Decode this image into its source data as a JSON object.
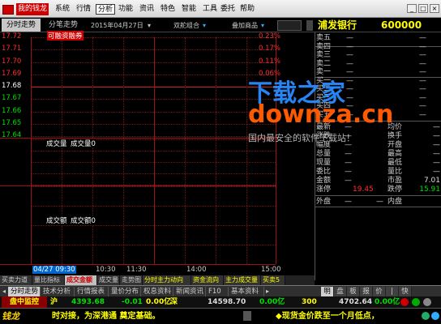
{
  "title_bar": {
    "app_button": "我的钱龙",
    "menu": [
      "系统",
      "行情",
      "分析",
      "功能",
      "资讯",
      "特色",
      "智能",
      "工具",
      "委托",
      "帮助"
    ],
    "selected_menu": "分析"
  },
  "tabs": {
    "tab1": "分时走势",
    "tab2": "分笔走势",
    "date": "2015年04月27日",
    "combo": "双舵组合",
    "overlay": "叠加商品"
  },
  "stock": {
    "name": "浦发银行",
    "code": "600000"
  },
  "chart": {
    "price_labels": [
      "17.72",
      "17.71",
      "17.70",
      "17.69",
      "17.68",
      "17.67",
      "17.66",
      "17.65",
      "17.64"
    ],
    "pct_labels": [
      "0.23%",
      "0.17%",
      "0.11%",
      "0.06%"
    ],
    "ref_price": "17.68",
    "panel_label_margin": "可融资融券",
    "vol_panel_title": "成交量",
    "vol_panel_value": "成交量0",
    "amt_panel_title": "成交额",
    "amt_panel_value": "成交额0",
    "x_labels": [
      "04/27 09:30",
      "10:30",
      "11:30",
      "14:00",
      "15:00"
    ]
  },
  "orderbook": {
    "asks": [
      {
        "label": "卖五",
        "price": "—",
        "vol": "—"
      },
      {
        "label": "卖四",
        "price": "—",
        "vol": "—"
      },
      {
        "label": "卖三",
        "price": "—",
        "vol": "—"
      },
      {
        "label": "卖二",
        "price": "—",
        "vol": "—"
      },
      {
        "label": "卖一",
        "price": "—",
        "vol": "—"
      }
    ],
    "bids": [
      {
        "label": "买一",
        "price": "—",
        "vol": "—"
      },
      {
        "label": "买二",
        "price": "—",
        "vol": "—"
      },
      {
        "label": "买三",
        "price": "—",
        "vol": "—"
      },
      {
        "label": "买四",
        "price": "—",
        "vol": "—"
      },
      {
        "label": "买五",
        "price": "—",
        "vol": "—"
      }
    ]
  },
  "stats": [
    {
      "l1": "最新",
      "v1": "—",
      "l2": "均价",
      "v2": "—"
    },
    {
      "l1": "涨跌",
      "v1": "—",
      "l2": "换手",
      "v2": "—"
    },
    {
      "l1": "幅度",
      "v1": "—",
      "l2": "开盘",
      "v2": "—"
    },
    {
      "l1": "总量",
      "v1": "—",
      "l2": "最高",
      "v2": "—"
    },
    {
      "l1": "现量",
      "v1": "—",
      "l2": "最低",
      "v2": "—"
    },
    {
      "l1": "委比",
      "v1": "—",
      "l2": "量比",
      "v2": "—"
    },
    {
      "l1": "金额",
      "v1": "—",
      "l2": "市盈",
      "v2": "7.01"
    },
    {
      "l1": "涨停",
      "v1": "19.45",
      "l2": "跌停",
      "v2": "15.91"
    }
  ],
  "outer_inner": {
    "outer": "外盘",
    "inner": "内盘",
    "outer_v": "—",
    "inner_v": "—"
  },
  "indicator_tabs": [
    "买卖力道",
    "量比指标",
    "成交金额",
    "成交量",
    "走势图",
    "分时主力动向",
    "资金流向",
    "主力成交量",
    "买卖5"
  ],
  "bottom_tabs": [
    "分时走势",
    "技术分析",
    "行情报表",
    "量价分布",
    "权息资料",
    "新闻资讯",
    "F10",
    "基本资料"
  ],
  "right_tabs": [
    "明",
    "盘",
    "板",
    "报",
    "价",
    "|",
    "快"
  ],
  "ticker": {
    "market_label": "盘中监控",
    "sh_label": "沪",
    "sh_value": "4393.68",
    "sh_change": "-0.01",
    "sh_amount": "0.00亿",
    "sz_label": "深",
    "sz_value": "14598.70",
    "sz_amount": "0.00亿",
    "cy_value": "300",
    "cy_index": "4702.64",
    "cy_amount": "0.00亿"
  },
  "status": {
    "logo": "钱龙",
    "scroll_text": "时对接，为深港通  奠定基础。",
    "news": "◆现货金价跌至一个月低点，"
  },
  "watermark": {
    "line1": "下载之家",
    "line2": "downza.cn",
    "line3": "国内最安全的软件下载站！"
  },
  "colors": {
    "red": "#ff3030",
    "green": "#00e000",
    "cyan": "#00ffff",
    "yellow": "#ffff00",
    "bg": "#000000"
  }
}
